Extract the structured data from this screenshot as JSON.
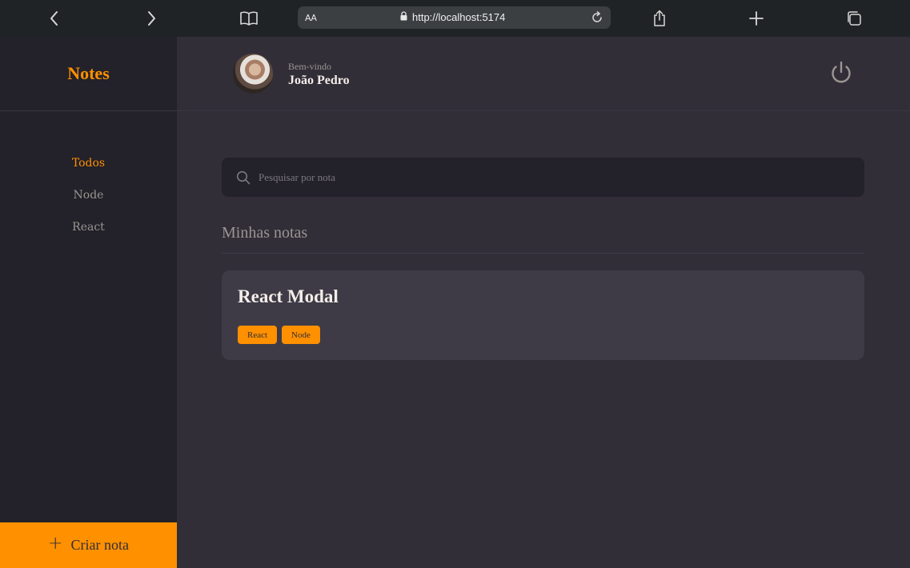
{
  "browser": {
    "reader_label": "AA",
    "url": "http://localhost:5174"
  },
  "sidebar": {
    "brand": "Notes",
    "tags": [
      {
        "label": "Todos",
        "active": true
      },
      {
        "label": "Node",
        "active": false
      },
      {
        "label": "React",
        "active": false
      }
    ],
    "create_label": "Criar nota"
  },
  "header": {
    "greeting": "Bem-vindo",
    "user_name": "João Pedro"
  },
  "search": {
    "placeholder": "Pesquisar por nota"
  },
  "main": {
    "section_title": "Minhas notas",
    "notes": [
      {
        "title": "React Modal",
        "tags": [
          "React",
          "Node"
        ]
      }
    ]
  },
  "colors": {
    "accent": "#FF9000",
    "background": "#312E38",
    "sidebar": "#232129",
    "card": "#3E3B47"
  }
}
